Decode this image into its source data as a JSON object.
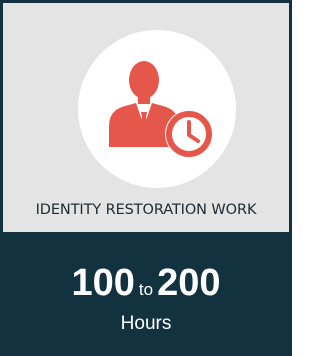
{
  "card": {
    "icon": "businessman-clock-icon",
    "title": "IDENTITY RESTORATION WORK",
    "range": {
      "from": "100",
      "connector": "to",
      "to": "200"
    },
    "unit": "Hours"
  },
  "colors": {
    "icon_red": "#e5574a",
    "top_background": "#e4e4e4",
    "bottom_background": "#12323f",
    "circle": "#ffffff"
  }
}
